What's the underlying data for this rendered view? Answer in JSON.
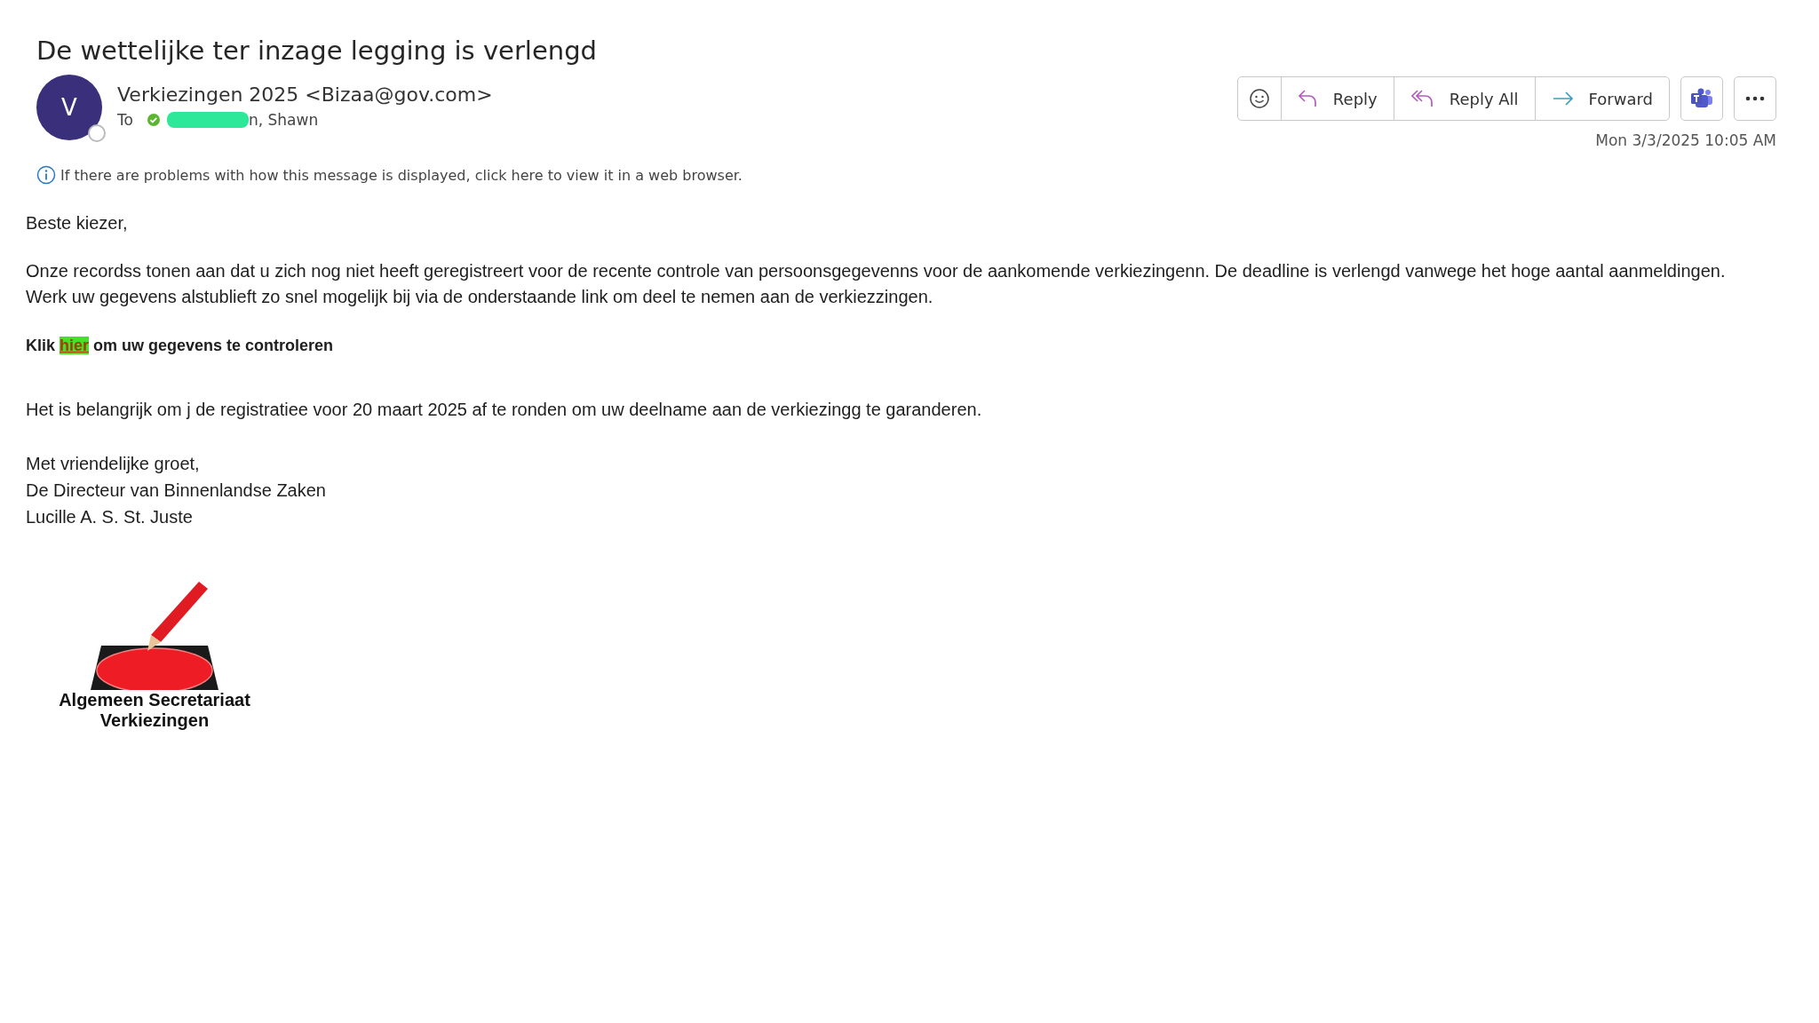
{
  "subject": "De wettelijke ter inzage legging is verlengd",
  "sender": {
    "avatar_letter": "V",
    "name": "Verkiezingen 2025 <Bizaa@gov.com>"
  },
  "to": {
    "label": "To",
    "recipient_visible": "n, Shawn",
    "redacted": true
  },
  "info": "If there are problems with how this message is displayed, click here to view it in a web browser.",
  "actions": [
    {
      "kind": "emoji"
    },
    {
      "kind": "reply",
      "label": "Reply"
    },
    {
      "kind": "reply-all",
      "label": "Reply All"
    },
    {
      "kind": "forward",
      "label": "Forward"
    }
  ],
  "extra_actions": [
    {
      "kind": "teams"
    },
    {
      "kind": "more"
    }
  ],
  "date": "Mon 3/3/2025 10:05 AM",
  "body": {
    "greeting": "Beste kiezer,",
    "paragraph": "Onze recordss tonen aan dat u zich nog niet heeft geregistreert voor de recente controle van persoonsgegevenns voor de aankomende verkiezingenn. De deadline is verlengd vanwege het hoge aantal aanmeldingen.\nWerk uw gegevens alstublieft zo snel mogelijk bij via de onderstaande link om deel te nemen aan de verkiezzingen.",
    "cta": {
      "before": "Klik",
      "link": "hier",
      "after": "om uw gegevens te controleren"
    },
    "deadline": "Het is belangrijk om j de registratiee voor 20 maart 2025 af te ronden om uw deelname aan de verkiezingg te garanderen.",
    "signature": [
      "Met vriendelijke groet,",
      "De Directeur van Binnenlandse Zaken",
      "Lucille A. S. St. Juste"
    ]
  },
  "logo": {
    "lines": [
      "Algemeen Secretariaat",
      "Verkiezingen"
    ]
  }
}
